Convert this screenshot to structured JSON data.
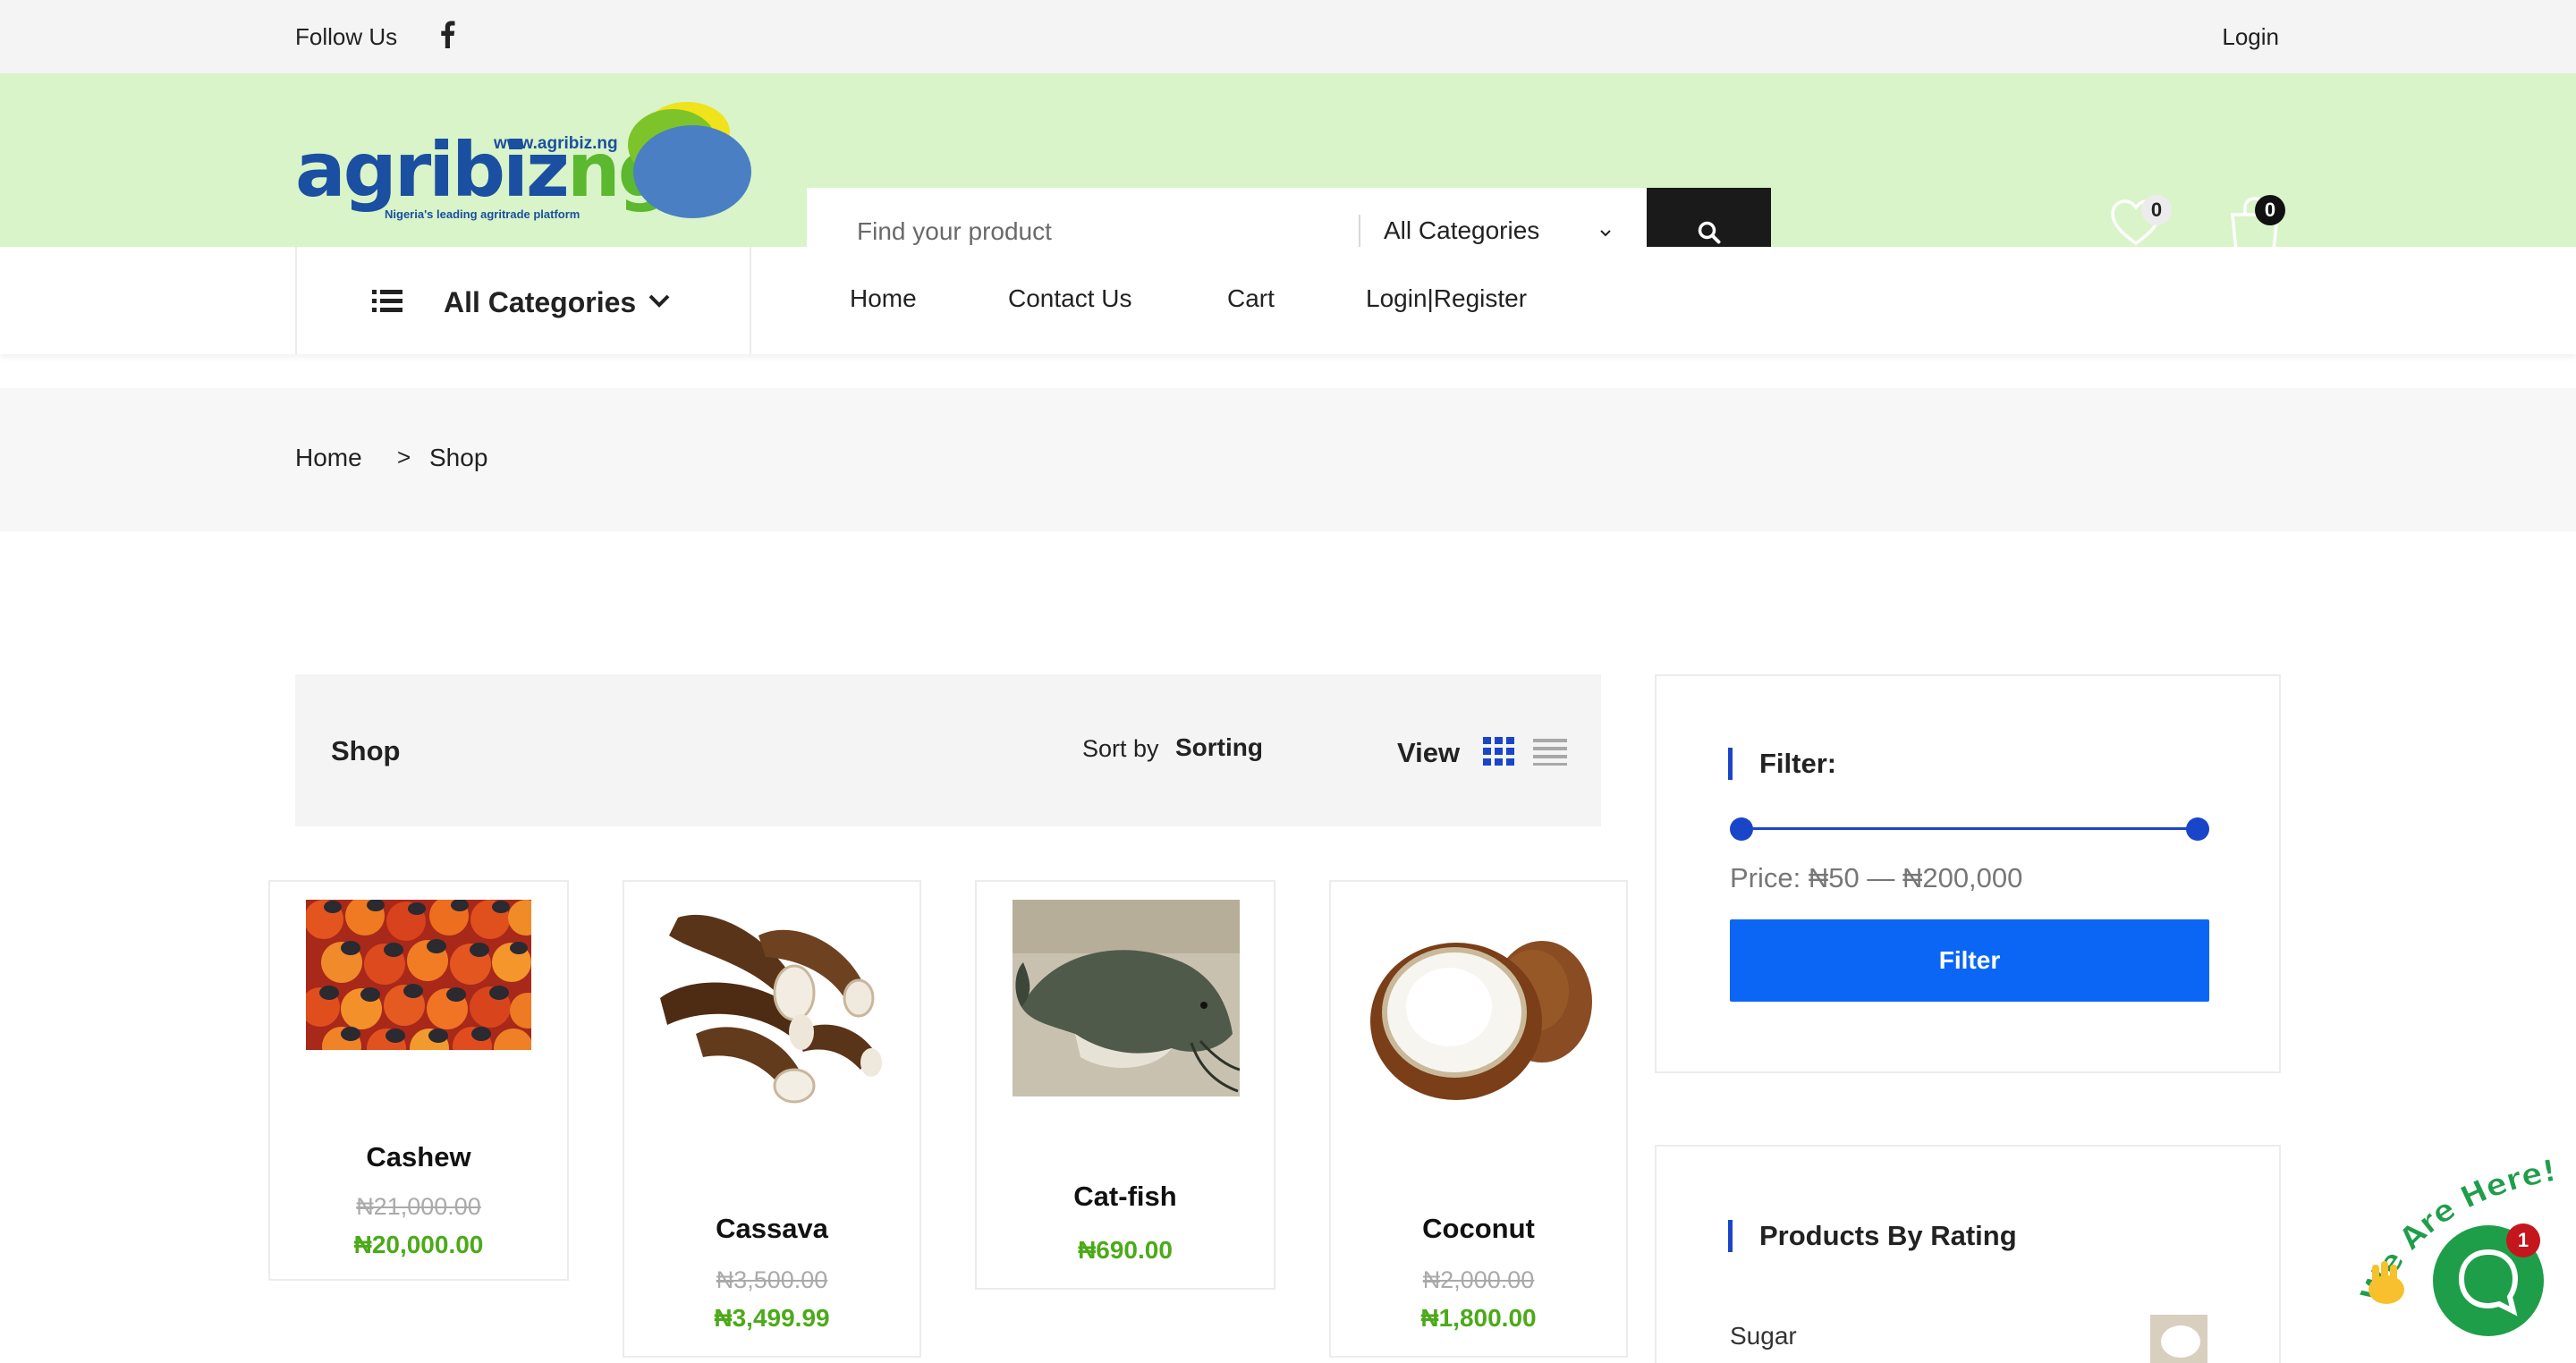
{
  "topbar": {
    "follow_label": "Follow Us",
    "login_label": "Login"
  },
  "logo": {
    "brand_main": "agribiz",
    "brand_suffix": "ng",
    "url": "www.agribiz.ng",
    "tagline": "Nigeria's leading agritrade platform"
  },
  "search": {
    "placeholder": "Find your product",
    "category": "All Categories"
  },
  "header": {
    "wishlist_count": "0",
    "cart_count": "0"
  },
  "nav": {
    "all_categories_label": "All Categories",
    "links": [
      "Home",
      "Contact Us",
      "Cart",
      "Login|Register"
    ]
  },
  "breadcrumb": {
    "home": "Home",
    "separator": ">",
    "current": "Shop"
  },
  "toolbar": {
    "title": "Shop",
    "sort_by": "Sort by",
    "sorting": "Sorting",
    "view": "View"
  },
  "products": [
    {
      "name": "Cashew",
      "old_price": "₦21,000.00",
      "price": "₦20,000.00"
    },
    {
      "name": "Cassava",
      "old_price": "₦3,500.00",
      "price": "₦3,499.99"
    },
    {
      "name": "Cat-fish",
      "old_price": "",
      "price": "₦690.00"
    },
    {
      "name": "Coconut",
      "old_price": "₦2,000.00",
      "price": "₦1,800.00"
    }
  ],
  "sidebar": {
    "filter_title": "Filter:",
    "price_label": "Price: ₦50 — ₦200,000",
    "filter_button": "Filter",
    "rating_title": "Products By Rating",
    "rating_product": "Sugar"
  },
  "chat": {
    "badge": "1",
    "banner": "We Are Here!"
  },
  "colors": {
    "header_bg": "#d9f4c8",
    "accent_blue": "#0b66f5",
    "price_green": "#4caa19",
    "chat_green": "#1f9e4a"
  }
}
